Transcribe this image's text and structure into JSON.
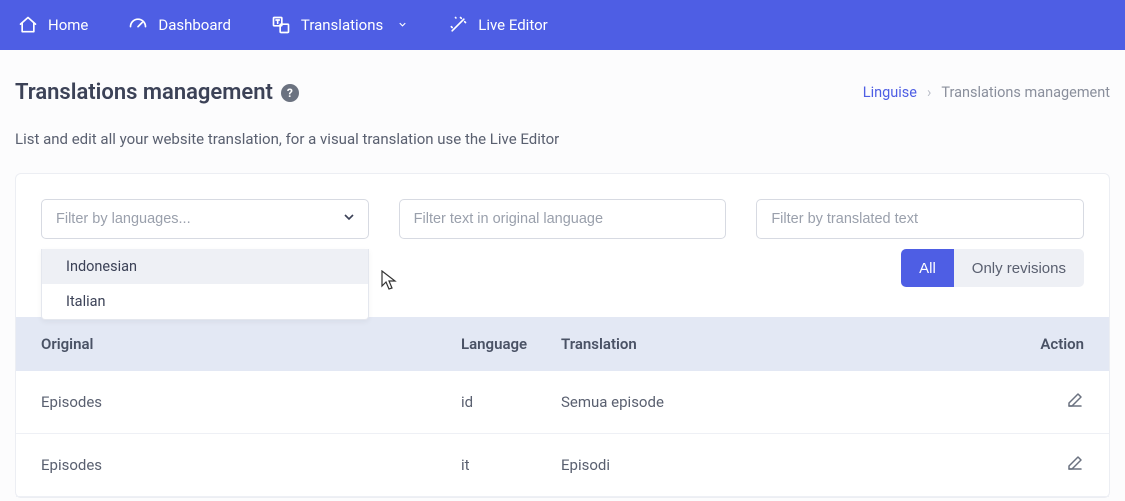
{
  "nav": {
    "home": "Home",
    "dashboard": "Dashboard",
    "translations": "Translations",
    "live_editor": "Live Editor"
  },
  "header": {
    "title": "Translations management",
    "breadcrumb_link": "Linguise",
    "breadcrumb_current": "Translations management"
  },
  "subtitle": "List and edit all your website translation, for a visual translation use the Live Editor",
  "filters": {
    "languages_placeholder": "Filter by languages...",
    "original_placeholder": "Filter text in original language",
    "translated_placeholder": "Filter by translated text"
  },
  "language_options": {
    "opt0": "Indonesian",
    "opt1": "Italian"
  },
  "toggles": {
    "all": "All",
    "revisions": "Only revisions"
  },
  "table": {
    "head": {
      "original": "Original",
      "language": "Language",
      "translation": "Translation",
      "action": "Action"
    },
    "rows": {
      "r0": {
        "original": "Episodes",
        "language": "id",
        "translation": "Semua episode"
      },
      "r1": {
        "original": "Episodes",
        "language": "it",
        "translation": "Episodi"
      }
    }
  }
}
